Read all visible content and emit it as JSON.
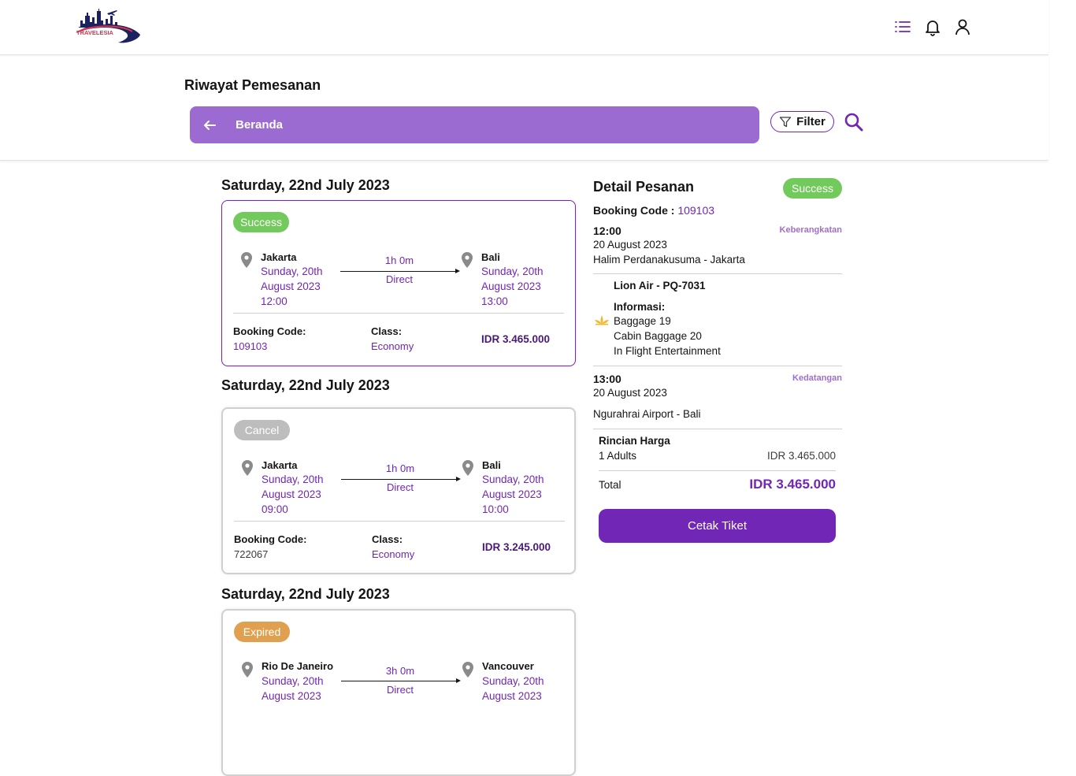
{
  "brand": {
    "logo_text": "TRAVELESIA"
  },
  "navbar": {
    "icons": [
      "list-icon",
      "bell-icon",
      "user-icon"
    ],
    "accent": "#7126b5"
  },
  "page": {
    "title": "Riwayat Pemesanan"
  },
  "search_bar": {
    "back_label": "Beranda",
    "filter_label": "Filter"
  },
  "orders": [
    {
      "date_heading": "Saturday, 22nd July 2023",
      "status": "Success",
      "status_color": "#73ca5c",
      "from": {
        "city": "Jakarta",
        "date1": "Sunday, 20th",
        "date2": "August 2023",
        "time": "12:00"
      },
      "to": {
        "city": "Bali",
        "date1": "Sunday, 20th",
        "date2": "August 2023",
        "time": "13:00"
      },
      "duration": "1h 0m",
      "flight_type": "Direct",
      "booking_code_label": "Booking Code:",
      "booking_code": "109103",
      "class_label": "Class:",
      "class": "Economy",
      "price": "IDR 3.465.000"
    },
    {
      "date_heading": "Saturday, 22nd July 2023",
      "status": "Cancel",
      "status_color": "#bdbdbd",
      "from": {
        "city": "Jakarta",
        "date1": "Sunday, 20th",
        "date2": "August 2023",
        "time": "09:00"
      },
      "to": {
        "city": "Bali",
        "date1": "Sunday, 20th",
        "date2": "August 2023",
        "time": "10:00"
      },
      "duration": "1h 0m",
      "flight_type": "Direct",
      "booking_code_label": "Booking Code:",
      "booking_code": "722067",
      "class_label": "Class:",
      "class": "Economy",
      "price": "IDR 3.245.000"
    },
    {
      "date_heading": "Saturday, 22nd July 2023",
      "status": "Expired",
      "status_color": "#e0a04f",
      "from": {
        "city": "Rio De Janeiro",
        "date1": "Sunday, 20th",
        "date2": "August 2023"
      },
      "to": {
        "city": "Vancouver",
        "date1": "Sunday, 20th",
        "date2": "August 2023"
      },
      "duration": "3h 0m",
      "flight_type": "Direct"
    }
  ],
  "detail": {
    "title": "Detail Pesanan",
    "status": "Success",
    "booking_code_label": "Booking Code :",
    "booking_code": "109103",
    "departure": {
      "time": "12:00",
      "tag": "Keberangkatan",
      "date": "20 August 2023",
      "airport": "Halim Perdanakusuma - Jakarta"
    },
    "airline": "Lion Air - PQ-7031",
    "info_label": "Informasi:",
    "info": [
      "Baggage 19",
      "Cabin Baggage 20",
      "In Flight Entertainment"
    ],
    "arrival": {
      "time": "13:00",
      "tag": "Kedatangan",
      "date": "20 August 2023",
      "airport": "Ngurahrai Airport - Bali"
    },
    "price_breakdown_label": "Rincian Harga",
    "adults_label": "1 Adults",
    "adults_price": "IDR 3.465.000",
    "total_label": "Total",
    "total_price": "IDR 3.465.000",
    "print_button": "Cetak Tiket"
  }
}
